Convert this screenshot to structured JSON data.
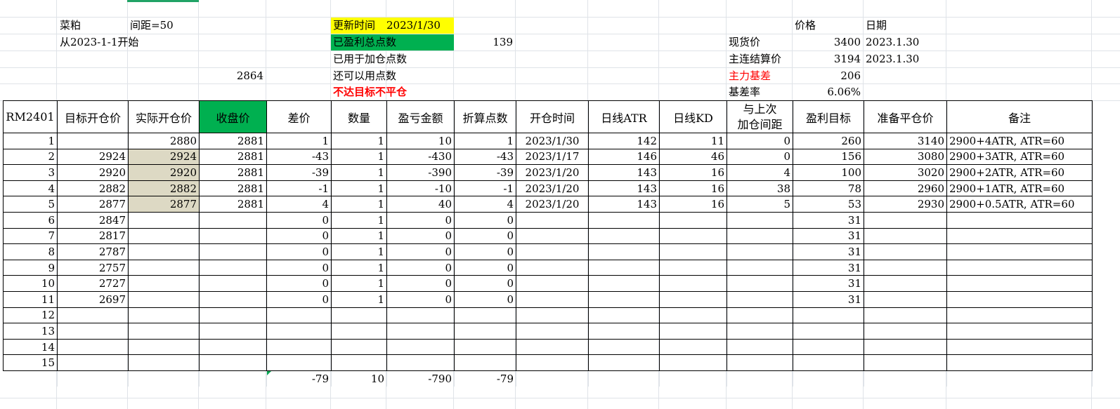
{
  "info": {
    "commodity": "菜粕",
    "spacing": "间距=50",
    "start_from": "从2023-1-1开始",
    "value_2864": "2864",
    "update_label": "更新时间",
    "update_date": "2023/1/30",
    "total_profit_label": "已盈利总点数",
    "total_profit_value": "139",
    "used_label": "已用于加仓点数",
    "remaining_label": "还可以用点数",
    "warning": "不达目标不平仓",
    "price_header": "价格",
    "date_header": "日期",
    "spot_label": "现货价",
    "spot_value": "3400",
    "spot_date": "2023.1.30",
    "settle_label": "主连结算价",
    "settle_value": "3194",
    "settle_date": "2023.1.30",
    "basis_label": "主力基差",
    "basis_value": "206",
    "basis_rate_label": "基差率",
    "basis_rate_value": "6.06%"
  },
  "table": {
    "headers": [
      "RM2401",
      "目标开仓价",
      "实际开仓价",
      "收盘价",
      "差价",
      "数量",
      "盈亏金额",
      "折算点数",
      "开仓时间",
      "日线ATR",
      "日线KD",
      "与上次\n加仓间距",
      "盈利目标",
      "准备平仓价",
      "备注"
    ],
    "header_dist_line1": "与上次",
    "header_dist_line2": "加仓间距",
    "rows": [
      [
        "1",
        "",
        "2880",
        "2881",
        "1",
        "1",
        "10",
        "1",
        "2023/1/30",
        "142",
        "11",
        "0",
        "260",
        "3140",
        "2900+4ATR,    ATR=60"
      ],
      [
        "2",
        "2924",
        "2924",
        "2881",
        "-43",
        "1",
        "-430",
        "-43",
        "2023/1/17",
        "146",
        "46",
        "0",
        "156",
        "3080",
        "2900+3ATR,    ATR=60"
      ],
      [
        "3",
        "2920",
        "2920",
        "2881",
        "-39",
        "1",
        "-390",
        "-39",
        "2023/1/20",
        "143",
        "16",
        "4",
        "100",
        "3020",
        "2900+2ATR,    ATR=60"
      ],
      [
        "4",
        "2882",
        "2882",
        "2881",
        "-1",
        "1",
        "-10",
        "-1",
        "2023/1/20",
        "143",
        "16",
        "38",
        "78",
        "2960",
        "2900+1ATR,    ATR=60"
      ],
      [
        "5",
        "2877",
        "2877",
        "2881",
        "4",
        "1",
        "40",
        "4",
        "2023/1/20",
        "143",
        "16",
        "5",
        "53",
        "2930",
        "2900+0.5ATR, ATR=60"
      ],
      [
        "6",
        "2847",
        "",
        "",
        "0",
        "1",
        "0",
        "0",
        "",
        "",
        "",
        "",
        "31",
        "",
        ""
      ],
      [
        "7",
        "2817",
        "",
        "",
        "0",
        "1",
        "0",
        "0",
        "",
        "",
        "",
        "",
        "31",
        "",
        ""
      ],
      [
        "8",
        "2787",
        "",
        "",
        "0",
        "1",
        "0",
        "0",
        "",
        "",
        "",
        "",
        "31",
        "",
        ""
      ],
      [
        "9",
        "2757",
        "",
        "",
        "0",
        "1",
        "0",
        "0",
        "",
        "",
        "",
        "",
        "31",
        "",
        ""
      ],
      [
        "10",
        "2727",
        "",
        "",
        "0",
        "1",
        "0",
        "0",
        "",
        "",
        "",
        "",
        "31",
        "",
        ""
      ],
      [
        "11",
        "2697",
        "",
        "",
        "0",
        "1",
        "0",
        "0",
        "",
        "",
        "",
        "",
        "31",
        "",
        ""
      ],
      [
        "12",
        "",
        "",
        "",
        "",
        "",
        "",
        "",
        "",
        "",
        "",
        "",
        "",
        "",
        ""
      ],
      [
        "13",
        "",
        "",
        "",
        "",
        "",
        "",
        "",
        "",
        "",
        "",
        "",
        "",
        "",
        ""
      ],
      [
        "14",
        "",
        "",
        "",
        "",
        "",
        "",
        "",
        "",
        "",
        "",
        "",
        "",
        "",
        ""
      ],
      [
        "15",
        "",
        "",
        "",
        "",
        "",
        "",
        "",
        "",
        "",
        "",
        "",
        "",
        "",
        ""
      ]
    ],
    "totals": [
      "",
      "",
      "",
      "",
      "-79",
      "10",
      "-790",
      "-79",
      "",
      "",
      "",
      "",
      "",
      "",
      ""
    ]
  },
  "colors": {
    "green_fill": "#00b050",
    "yellow_fill": "#ffff00",
    "tan_fill": "#ddd9c4",
    "red_text": "#ff0000",
    "gridline": "#dfe3e8"
  }
}
